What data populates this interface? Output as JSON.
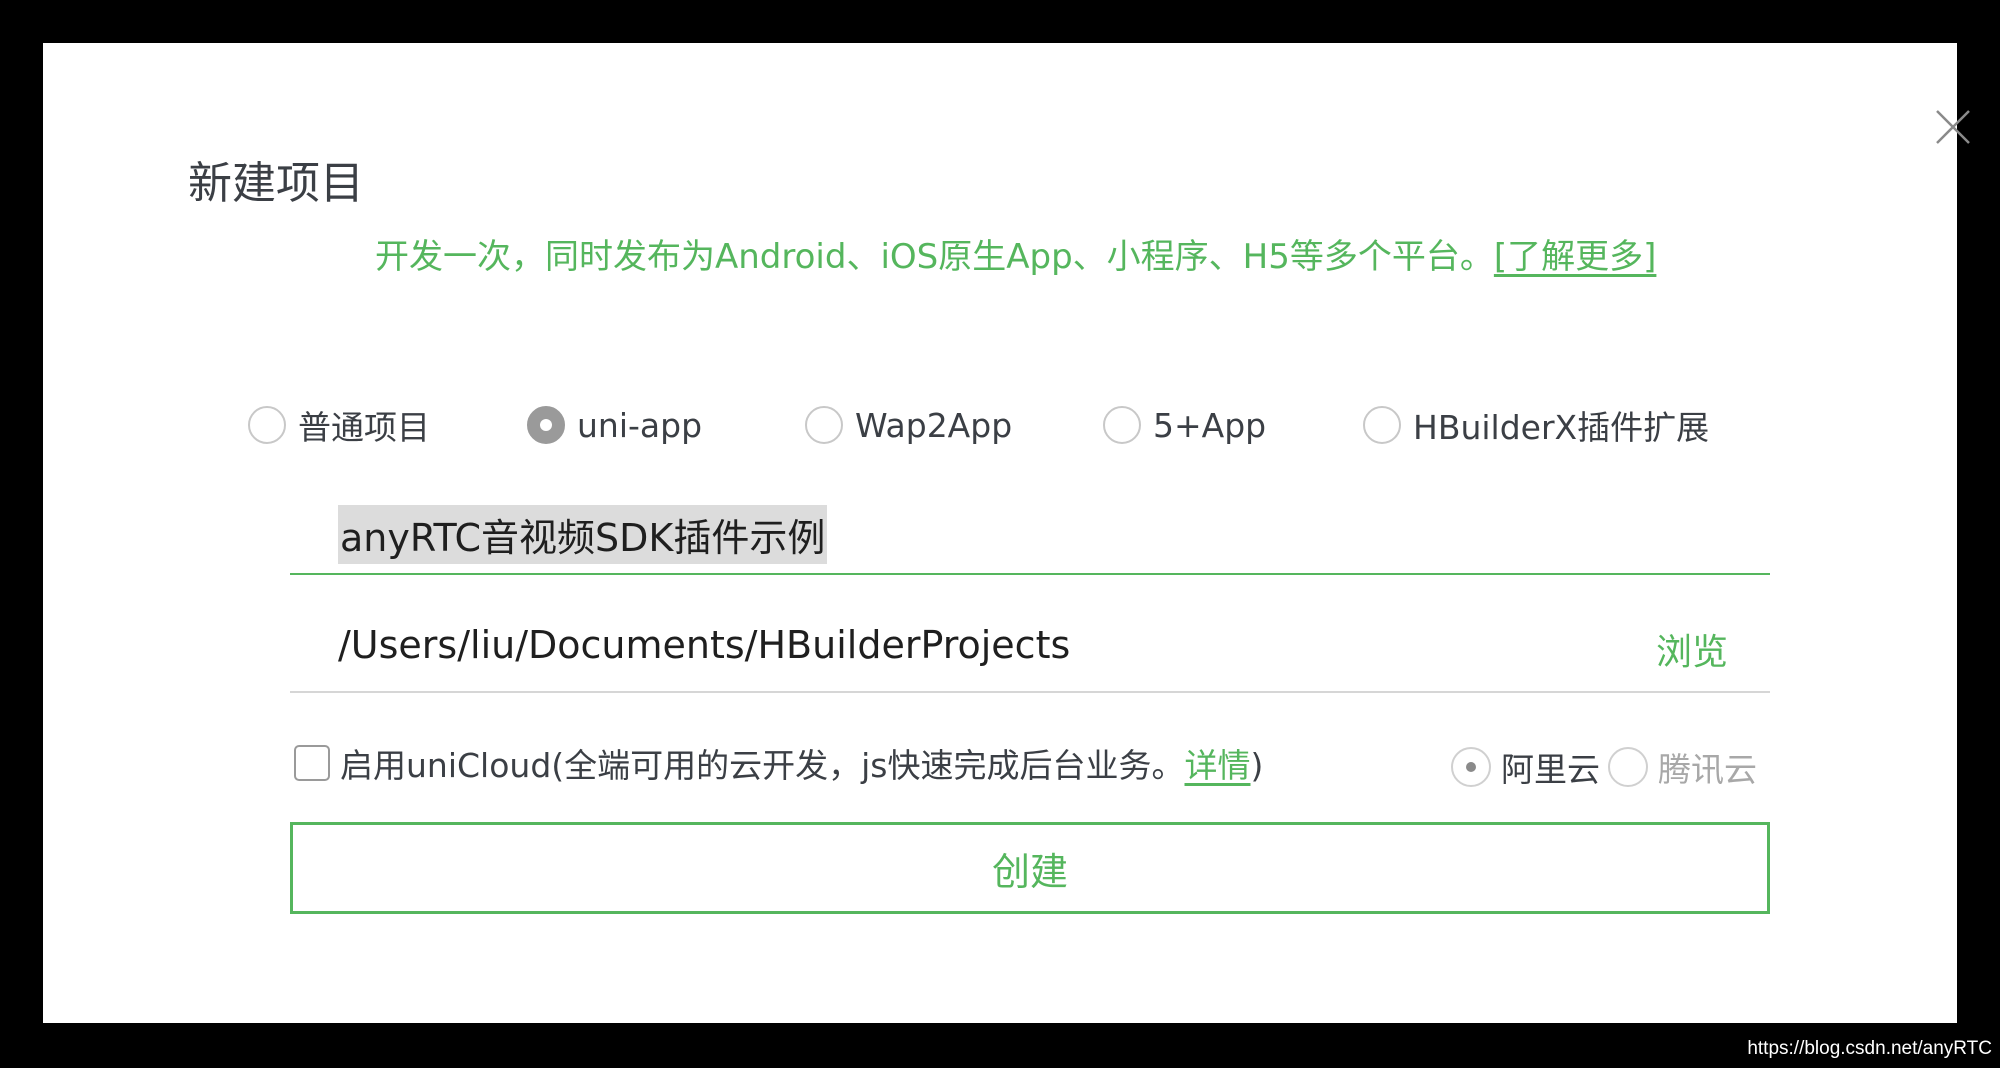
{
  "dialog": {
    "title": "新建项目",
    "subtitle_text": "开发一次，同时发布为Android、iOS原生App、小程序、H5等多个平台。",
    "subtitle_link": "[了解更多]"
  },
  "project_types": [
    {
      "label": "普通项目",
      "checked": false
    },
    {
      "label": "uni-app",
      "checked": true
    },
    {
      "label": "Wap2App",
      "checked": false
    },
    {
      "label": "5+App",
      "checked": false
    },
    {
      "label": "HBuilderX插件扩展",
      "checked": false
    }
  ],
  "project_name": {
    "value": "anyRTC音视频SDK插件示例"
  },
  "project_path": {
    "value": "/Users/liu/Documents/HBuilderProjects",
    "browse_label": "浏览"
  },
  "unicloud": {
    "checked": false,
    "text_before": "启用uniCloud(全端可用的云开发，js快速完成后台业务。",
    "detail_link": "详情",
    "text_after": ")",
    "providers": [
      {
        "label": "阿里云",
        "selected": true,
        "enabled": true
      },
      {
        "label": "腾讯云",
        "selected": false,
        "enabled": false
      }
    ]
  },
  "actions": {
    "create_label": "创建"
  },
  "watermark": "https://blog.csdn.net/anyRTC",
  "colors": {
    "accent": "#55b65d",
    "text": "#3b3f45",
    "backdrop": "#000000"
  },
  "icons": {
    "close": "close-icon"
  }
}
